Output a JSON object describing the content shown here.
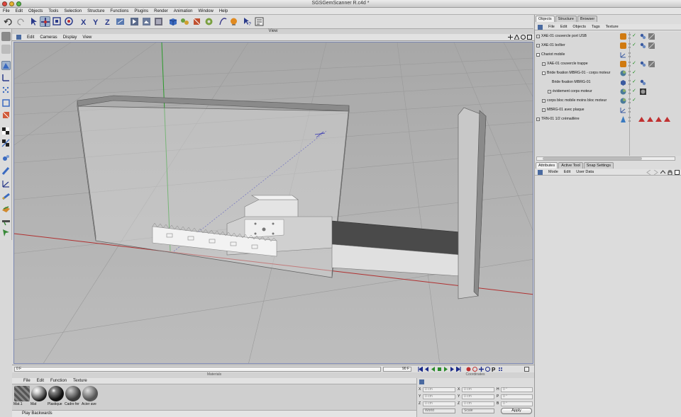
{
  "window": {
    "title": "SGSGemScanner R.c4d *"
  },
  "menubar": [
    "File",
    "Edit",
    "Objects",
    "Tools",
    "Selection",
    "Structure",
    "Functions",
    "Plugins",
    "Render",
    "Animation",
    "Window",
    "Help"
  ],
  "toolbar_icons": [
    "undo-icon",
    "redo-icon",
    "select-arrow-icon",
    "move-icon",
    "scale-icon",
    "rotate-icon",
    "axis-x-icon",
    "axis-y-icon",
    "axis-z-icon",
    "coordinate-system-icon",
    "render-view-icon",
    "render-picture-viewer-icon",
    "render-settings-icon",
    "cube-primitive-icon",
    "nurbs-icon",
    "deformer-icon",
    "array-icon",
    "spline-pen-icon",
    "light-icon",
    "help-icon",
    "layout-icon"
  ],
  "viewport": {
    "title": "View",
    "menu": [
      "Edit",
      "Cameras",
      "Display",
      "View"
    ]
  },
  "timeline": {
    "current_frame": "0 F",
    "end_frame": "90 F"
  },
  "materials": {
    "title": "Materials",
    "menu": [
      "File",
      "Edit",
      "Function",
      "Texture"
    ],
    "items": [
      {
        "name": "Mat.1",
        "color": "#6b6b6b"
      },
      {
        "name": "Mat",
        "color": "#1a1a1a"
      },
      {
        "name": "Plastique",
        "color": "#111111"
      },
      {
        "name": "Cadre fer",
        "color": "#3a3a3a"
      },
      {
        "name": "Acier ave",
        "color": "#555555"
      }
    ]
  },
  "coordinates": {
    "title": "Coordinates",
    "rows": [
      {
        "a": "X",
        "a_val": "0 cm",
        "b": "X",
        "b_val": "0 cm",
        "c": "H",
        "c_val": "0 °"
      },
      {
        "a": "Y",
        "a_val": "0 cm",
        "b": "Y",
        "b_val": "0 cm",
        "c": "P",
        "c_val": "0 °"
      },
      {
        "a": "Z",
        "a_val": "0 cm",
        "b": "Z",
        "b_val": "0 cm",
        "c": "B",
        "c_val": "0 °"
      }
    ],
    "mode_select": "World",
    "scale_select": "Scale",
    "apply_label": "Apply"
  },
  "status": {
    "text": "Play Backwards"
  },
  "objects_panel": {
    "tabs": [
      "Objects",
      "Structure",
      "Browser"
    ],
    "menu": [
      "File",
      "Edit",
      "Objects",
      "Tags",
      "Texture"
    ],
    "items": [
      {
        "name": "XAE-01 couvercle port USB",
        "indent": 0,
        "expander": "+",
        "icon_color": "#d07a10"
      },
      {
        "name": "XAE-01 boîtier",
        "indent": 0,
        "expander": "+",
        "icon_color": "#d07a10"
      },
      {
        "name": "Chariot mobile",
        "indent": 0,
        "expander": "-",
        "icon_color": "#dcdcdc"
      },
      {
        "name": "XAE-01 couvercle trappe",
        "indent": 1,
        "expander": "+",
        "icon_color": "#d07a10"
      },
      {
        "name": "Bride fixation MBRG-01 - corps moteur",
        "indent": 1,
        "expander": "-",
        "icon_color": "#4a7a9a"
      },
      {
        "name": "Bride fixation MBRG-01",
        "indent": 2,
        "expander": "",
        "icon_color": "#3a5aa0"
      },
      {
        "name": "évidement corps moteur",
        "indent": 2,
        "expander": "+",
        "icon_color": "#4a7a9a"
      },
      {
        "name": "corps bloc mobile moins bloc moteur",
        "indent": 1,
        "expander": "+",
        "icon_color": "#4a7a9a"
      },
      {
        "name": "MBRG-01 avec plaque",
        "indent": 1,
        "expander": "+",
        "icon_color": "#dcdcdc"
      },
      {
        "name": "TRN-01 1/2 crémaillère",
        "indent": 0,
        "expander": "+",
        "icon_color": "#3a7ac0"
      }
    ]
  },
  "attributes_panel": {
    "tabs": [
      "Attributes",
      "Active Tool",
      "Snap Settings"
    ],
    "menu": [
      "Mode",
      "Edit",
      "User Data"
    ]
  },
  "colors": {
    "selection_blue": "#9fb2cc",
    "viewport_bg": "#b8b8b8",
    "axis_red": "#b03030",
    "axis_green": "#30a030",
    "axis_blue": "#3030b0"
  }
}
